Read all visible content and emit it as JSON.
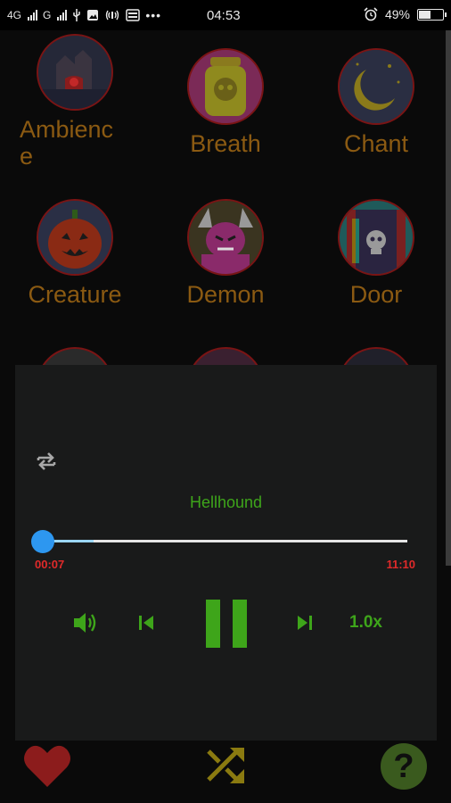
{
  "status_bar": {
    "network_1": "4G",
    "network_2": "G",
    "time": "04:53",
    "battery": "49%",
    "icons": [
      "signal-icon",
      "usb-icon",
      "image-icon",
      "hotspot-icon",
      "storage-icon",
      "more-icon",
      "alarm-icon",
      "battery-icon"
    ]
  },
  "sounds": [
    {
      "label": "Ambience",
      "label_display": [
        "Ambienc",
        "e"
      ],
      "icon": "haunted-house-icon"
    },
    {
      "label": "Breath",
      "icon": "jar-skull-icon"
    },
    {
      "label": "Chant",
      "icon": "moon-night-icon"
    },
    {
      "label": "Creature",
      "icon": "pumpkin-icon"
    },
    {
      "label": "Demon",
      "icon": "demon-icon"
    },
    {
      "label": "Door",
      "icon": "door-skull-icon"
    }
  ],
  "player": {
    "track_title": "Hellhound",
    "current_time": "00:07",
    "total_time": "11:10",
    "progress": 0.011,
    "buffered": 0.15,
    "speed_label": "1.0x",
    "state": "playing",
    "accent_color": "#3ea51a",
    "time_color": "#e02a2a",
    "seek_thumb_color": "#2d97f0"
  },
  "bottom_bar": {
    "icons": [
      "heart-icon",
      "shuffle-icon",
      "help-icon"
    ]
  }
}
